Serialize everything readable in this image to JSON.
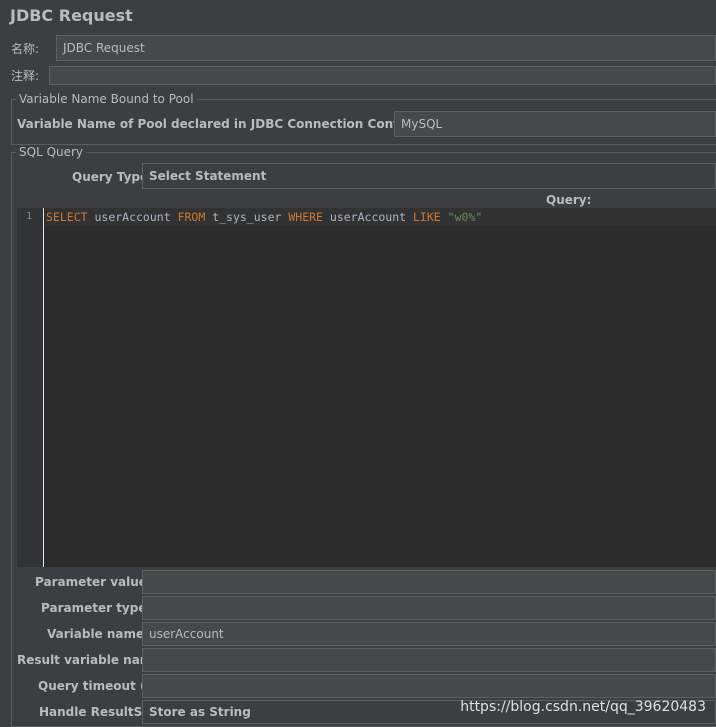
{
  "window": {
    "title": "JDBC Request"
  },
  "name": {
    "label": "名称:",
    "value": "JDBC Request"
  },
  "comment": {
    "label": "注释:",
    "value": ""
  },
  "pool_group": {
    "title": "Variable Name Bound to Pool",
    "label": "Variable Name of Pool declared in JDBC Connection Configuration:",
    "value": "MySQL"
  },
  "sql_group": {
    "title": "SQL Query",
    "query_type_label": "Query Type:",
    "query_type_value": "Select Statement",
    "query_label": "Query:",
    "line_number": "1",
    "code": {
      "kw_select": "SELECT",
      "col": " userAccount ",
      "kw_from": "FROM",
      "table": " t_sys_user ",
      "kw_where": "WHERE",
      "col2": " userAccount ",
      "kw_like": "LIKE",
      "space": " ",
      "literal": "\"w0%\""
    }
  },
  "params": {
    "parameter_values_label": "Parameter values:",
    "parameter_values": "",
    "parameter_types_label": "Parameter types:",
    "parameter_types": "",
    "variable_names_label": "Variable names:",
    "variable_names": "userAccount",
    "result_variable_label": "Result variable name:",
    "result_variable": "",
    "timeout_label": "Query timeout (s):",
    "timeout": "",
    "handle_resultset_label": "Handle ResultSet:",
    "handle_resultset": "Store as String"
  },
  "watermark": "https://blog.csdn.net/qq_39620483",
  "colors": {
    "background": "#3c3f41",
    "editor": "#2b2b2b",
    "keyword": "#cc7832",
    "string": "#6a8759",
    "text": "#bbbbbb"
  }
}
